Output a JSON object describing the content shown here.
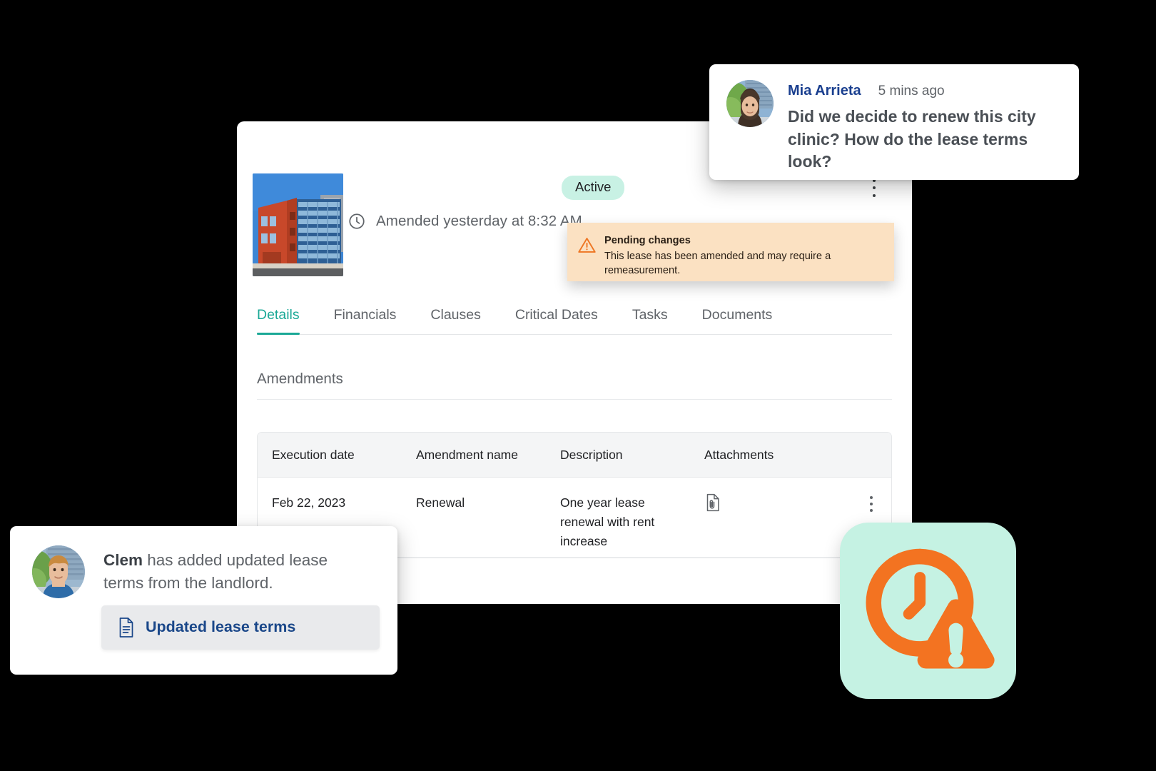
{
  "app_panel": {
    "building_thumbnail": "building-photo",
    "amended_text": "Amended yesterday at 8:32 AM",
    "clock_icon": "clock-icon",
    "status_badge": "Active",
    "overflow_icon": "kebab-menu-icon",
    "pending_banner": {
      "icon": "warning-triangle-icon",
      "title": "Pending changes",
      "body": "This lease has been amended and may require a remeasurement."
    },
    "tabs": [
      {
        "label": "Details",
        "active": true
      },
      {
        "label": "Financials",
        "active": false
      },
      {
        "label": "Clauses",
        "active": false
      },
      {
        "label": "Critical Dates",
        "active": false
      },
      {
        "label": "Tasks",
        "active": false
      },
      {
        "label": "Documents",
        "active": false
      }
    ],
    "section_title": "Amendments",
    "table": {
      "columns": [
        "Execution date",
        "Amendment name",
        "Description",
        "Attachments"
      ],
      "rows": [
        {
          "execution_date": "Feb 22, 2023",
          "amendment_name": "Renewal",
          "description": "One year lease renewal with rent increase",
          "attachment_icon": "attachment-document-icon",
          "row_menu_icon": "kebab-menu-icon"
        }
      ]
    }
  },
  "comment_card": {
    "avatar": "avatar-mia",
    "author": "Mia Arrieta",
    "time": "5 mins ago",
    "message": "Did we decide to renew this city clinic? How do the lease terms look?"
  },
  "notification_card": {
    "avatar": "avatar-clem",
    "actor": "Clem",
    "message_rest": " has added updated lease terms from the landlord.",
    "attachment": {
      "icon": "document-icon",
      "label": "Updated lease terms"
    }
  },
  "alert_tile": {
    "icon": "clock-with-warning-icon",
    "background_color": "#C5F2E3",
    "icon_color": "#F37321"
  },
  "colors": {
    "accent_teal": "#1AA896",
    "badge_mint": "#C8F1E4",
    "banner_peach": "#FBE1C2",
    "warning_orange": "#F37321",
    "link_navy": "#1A4789",
    "author_navy": "#1A3F8F",
    "text_gray": "#5F6368",
    "text_dark": "#202124"
  }
}
